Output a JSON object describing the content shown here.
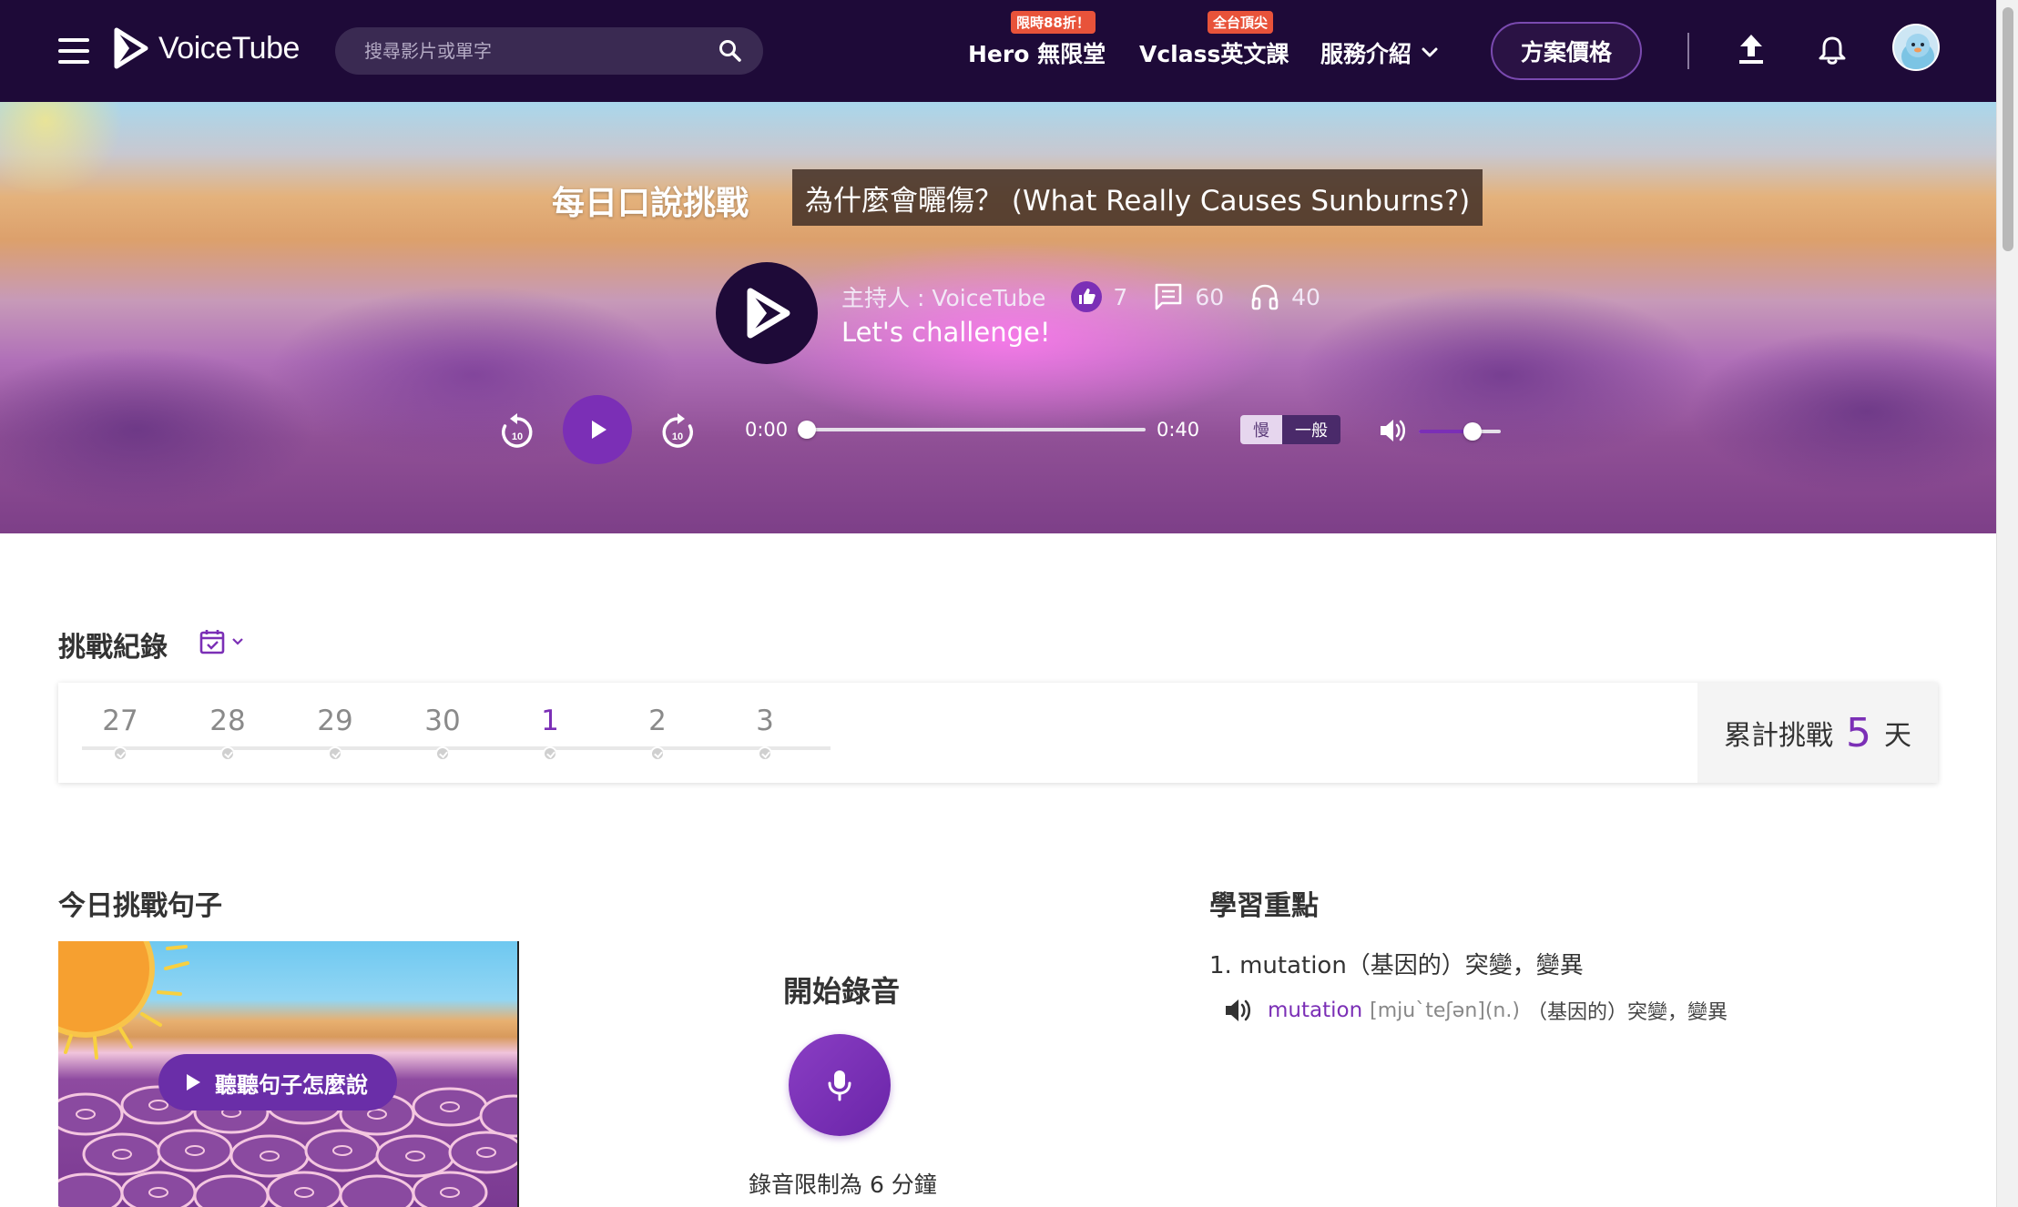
{
  "nav": {
    "logo_text": "VoiceTube",
    "search_placeholder": "搜尋影片或單字",
    "hero_label": "Hero 無限堂",
    "hero_badge": "限時88折！",
    "vclass_label": "Vclass英文課",
    "vclass_badge": "全台頂尖",
    "service_label": "服務介紹",
    "plan_button": "方案價格"
  },
  "hero": {
    "challenge_label": "每日口說挑戰",
    "title": "為什麼會曬傷？ (What Really Causes Sunburns?)",
    "host": "主持人 : VoiceTube",
    "likes": "7",
    "comments": "60",
    "listens": "40",
    "subtitle": "Let's challenge!",
    "player": {
      "current_time": "0:00",
      "total_time": "0:40",
      "progress": 0,
      "speed_slow": "慢",
      "speed_normal": "一般",
      "volume": 0.65
    }
  },
  "record": {
    "title": "挑戰紀錄",
    "days": [
      {
        "label": "27",
        "active": false
      },
      {
        "label": "28",
        "active": false
      },
      {
        "label": "29",
        "active": false
      },
      {
        "label": "30",
        "active": false
      },
      {
        "label": "1",
        "active": true
      },
      {
        "label": "2",
        "active": false
      },
      {
        "label": "3",
        "active": false
      }
    ],
    "total_prefix": "累計挑戰",
    "total_count": "5",
    "total_suffix": "天"
  },
  "today": {
    "title": "今日挑戰句子",
    "listen_button": "聽聽句子怎麼說",
    "record_label": "開始錄音",
    "limit_text": "錄音限制為 6 分鐘"
  },
  "learning": {
    "title": "學習重點",
    "point_heading": "1. mutation（基因的）突變，變異",
    "word": "mutation",
    "phonetic": "[mju`teʃən](n.)",
    "definition": "（基因的）突變，變異"
  },
  "colors": {
    "nav_bg": "#1e0a38",
    "accent": "#7b2fb6",
    "badge": "#e8533a"
  }
}
